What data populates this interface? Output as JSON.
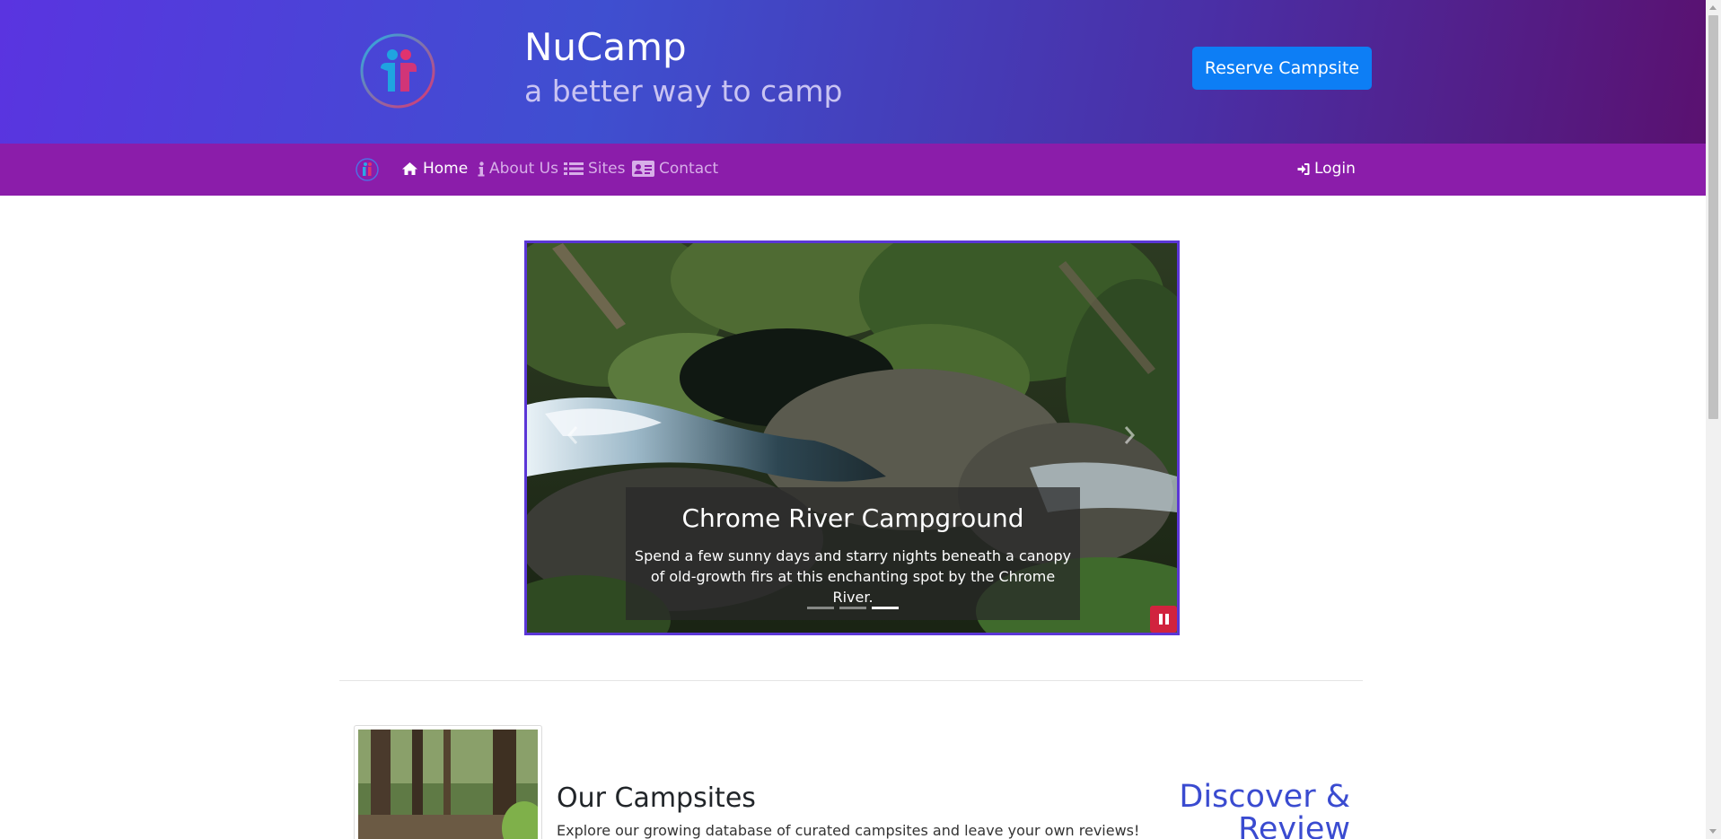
{
  "header": {
    "title": "NuCamp",
    "subtitle": "a better way to camp",
    "reserve_label": "Reserve Campsite",
    "logo_icon": "nucamp-logo-icon"
  },
  "nav": {
    "items": [
      {
        "label": "Home",
        "icon": "home-icon",
        "active": true
      },
      {
        "label": "About Us",
        "icon": "info-icon",
        "active": false
      },
      {
        "label": "Sites",
        "icon": "list-icon",
        "active": false
      },
      {
        "label": "Contact",
        "icon": "address-card-icon",
        "active": false
      }
    ],
    "login_label": "Login"
  },
  "carousel": {
    "slide_title": "Chrome River Campground",
    "slide_text": "Spend a few sunny days and starry nights beneath a canopy of old-growth firs at this enchanting spot by the Chrome River.",
    "slide_count": 3,
    "active_slide": 3,
    "paused": false
  },
  "campsites": {
    "title": "Our Campsites",
    "text": "Explore our growing database of curated campsites and leave your own reviews!",
    "tagline": "Discover & Review"
  },
  "colors": {
    "navbar": "#8b1daa",
    "reserve_button": "#0d7ef5",
    "carousel_border": "#5b36d6",
    "pause_button": "#d1233e",
    "accent_text": "#3a4bd0"
  }
}
